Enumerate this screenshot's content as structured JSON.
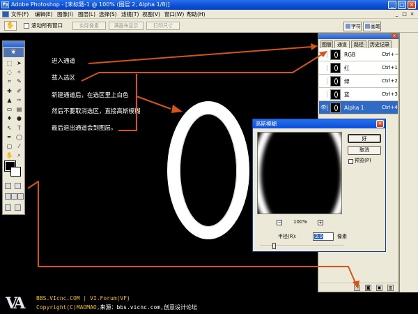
{
  "window": {
    "title": "Adobe Photoshop - [未标题-1 @ 100% (图层 2, Alpha 1/8)]",
    "app_icon": "Ps",
    "buttons": [
      "_",
      "□",
      "×"
    ]
  },
  "menu": {
    "items": [
      "文件(F)",
      "编辑(E)",
      "图像(I)",
      "图层(L)",
      "选择(S)",
      "滤镜(T)",
      "视图(V)",
      "窗口(W)",
      "帮助(H)"
    ],
    "controls": [
      "_",
      "□",
      "×"
    ]
  },
  "options_bar": {
    "checkbox_label": "滚动所有窗口",
    "buttons": [
      "实际像素",
      "满画布显示",
      "打印尺寸"
    ],
    "palette_tabs": [
      "字符",
      "画笔"
    ]
  },
  "notes": [
    "进入通道",
    "载入选区",
    "新建通道后，在选区里上白色",
    "然后不要取消选区，直接高斯模糊",
    "最后退出通道会到图层。"
  ],
  "channels_panel": {
    "tabs": [
      "图层",
      "通道",
      "路径",
      "历史记录"
    ],
    "rows": [
      {
        "name": "RGB",
        "shortcut": "Ctrl+~"
      },
      {
        "name": "红",
        "shortcut": "Ctrl+1"
      },
      {
        "name": "绿",
        "shortcut": "Ctrl+2"
      },
      {
        "name": "蓝",
        "shortcut": "Ctrl+3"
      },
      {
        "name": "Alpha 1",
        "shortcut": "Ctrl+4"
      }
    ]
  },
  "gaussian_dialog": {
    "title": "高斯模糊",
    "ok_label": "好",
    "cancel_label": "取消",
    "preview_label": "预览(P)",
    "zoom": "100%",
    "zoom_out": "−",
    "zoom_in": "+",
    "radius_label": "半径(R):",
    "radius_value": "3.0",
    "unit": "像素"
  },
  "footer": {
    "logo": "VA",
    "site": "BBS.VIcnc.COM | VI.Forum(VF)",
    "copyright": "Copyright(C)MAOMAO,",
    "source": "来源：bbs.vicnc.com,创意设计论坛"
  },
  "colors": {
    "arrow": "#d4541a",
    "selected_row": "#316ac5",
    "credit": "#f2c200"
  }
}
